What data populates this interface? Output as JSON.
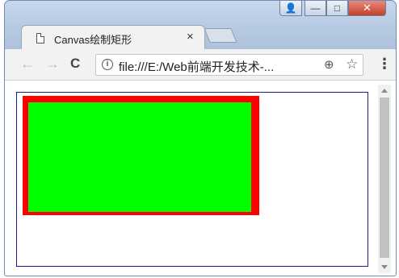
{
  "window": {
    "controls": {
      "user": "👤",
      "minimize": "—",
      "maximize": "□",
      "close": "✕"
    }
  },
  "tab": {
    "title": "Canvas绘制矩形",
    "close_glyph": "×",
    "icon": "page-icon"
  },
  "toolbar": {
    "back_glyph": "←",
    "forward_glyph": "→",
    "reload_glyph": "C",
    "info_glyph": "i",
    "url": "file:///E:/Web前端开发技术-...",
    "zoom_glyph": "⊕",
    "star_glyph": "☆",
    "menu_glyph": "⋮"
  },
  "canvas": {
    "border_color": "#1a1a8c",
    "stroke_color": "#ff0000",
    "fill_color": "#00ff00"
  }
}
